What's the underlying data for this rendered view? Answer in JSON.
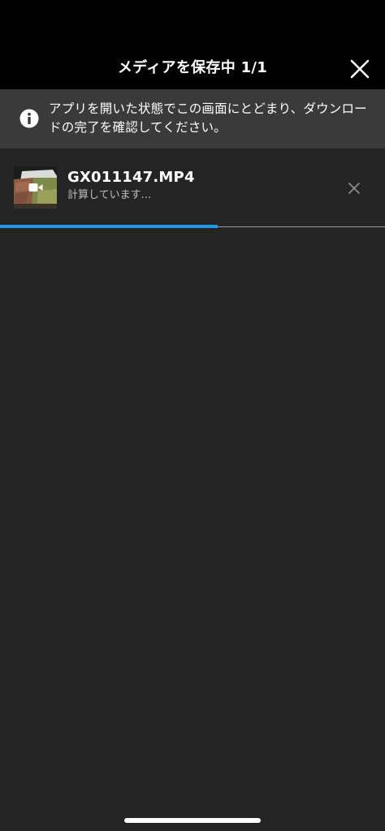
{
  "header": {
    "title": "メディアを保存中 1/1",
    "close_icon": "close-icon"
  },
  "banner": {
    "icon": "info-icon",
    "message": "アプリを開いた状態でこの画面にとどまり、ダウンロードの完了を確認してください。"
  },
  "download": {
    "file_name": "GX011147.MP4",
    "status": "計算しています...",
    "thumbnail_badge_icon": "video-camera-icon",
    "cancel_icon": "close-icon",
    "progress_percent": 56.5
  },
  "colors": {
    "navbar_bg": "#000000",
    "banner_bg": "#3a3a3a",
    "content_bg": "#242424",
    "progress_accent": "#1f9ae8"
  }
}
